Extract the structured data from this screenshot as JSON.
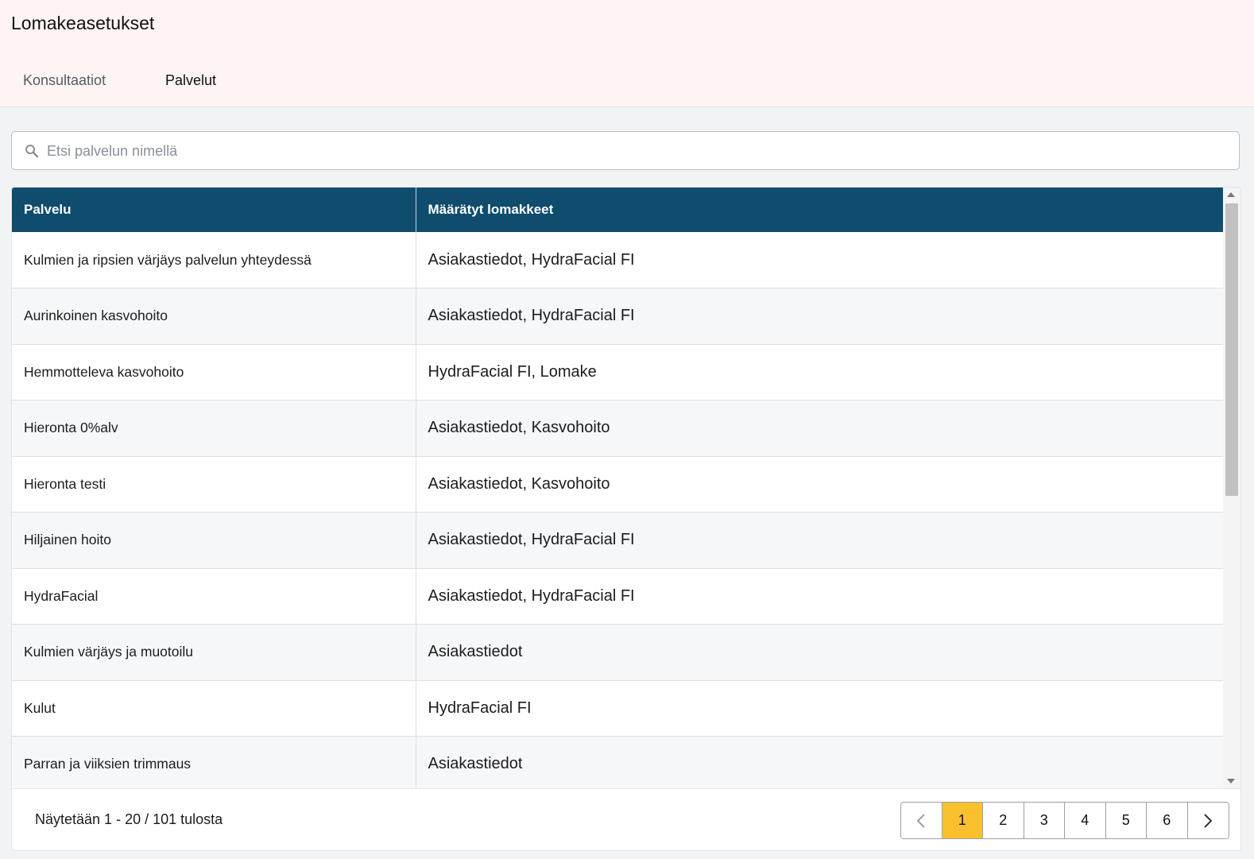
{
  "header": {
    "title": "Lomakeasetukset",
    "tabs": [
      {
        "label": "Konsultaatiot",
        "active": false
      },
      {
        "label": "Palvelut",
        "active": true
      }
    ]
  },
  "search": {
    "icon": "search-icon",
    "placeholder": "Etsi palvelun nimellä",
    "value": ""
  },
  "table": {
    "columns": [
      "Palvelu",
      "Määrätyt lomakkeet"
    ],
    "header_color": "#0f4c6e",
    "rows": [
      {
        "service": "Kulmien ja ripsien värjäys palvelun yhteydessä",
        "forms": "Asiakastiedot, HydraFacial FI"
      },
      {
        "service": "Aurinkoinen kasvohoito",
        "forms": "Asiakastiedot, HydraFacial FI"
      },
      {
        "service": "Hemmotteleva kasvohoito",
        "forms": "HydraFacial FI, Lomake"
      },
      {
        "service": "Hieronta 0%alv",
        "forms": "Asiakastiedot, Kasvohoito"
      },
      {
        "service": "Hieronta testi",
        "forms": "Asiakastiedot, Kasvohoito"
      },
      {
        "service": "Hiljainen hoito",
        "forms": "Asiakastiedot, HydraFacial FI"
      },
      {
        "service": "HydraFacial",
        "forms": "Asiakastiedot, HydraFacial FI"
      },
      {
        "service": "Kulmien värjäys ja muotoilu",
        "forms": "Asiakastiedot"
      },
      {
        "service": "Kulut",
        "forms": "HydraFacial FI"
      },
      {
        "service": "Parran ja viiksien trimmaus",
        "forms": "Asiakastiedot"
      }
    ]
  },
  "footer": {
    "results_text": "Näytetään 1 - 20 / 101 tulosta"
  },
  "pagination": {
    "prev_icon": "chevron-left-icon",
    "next_icon": "chevron-right-icon",
    "pages": [
      "1",
      "2",
      "3",
      "4",
      "5",
      "6"
    ],
    "current": "1",
    "accent_color": "#fbc02d"
  }
}
